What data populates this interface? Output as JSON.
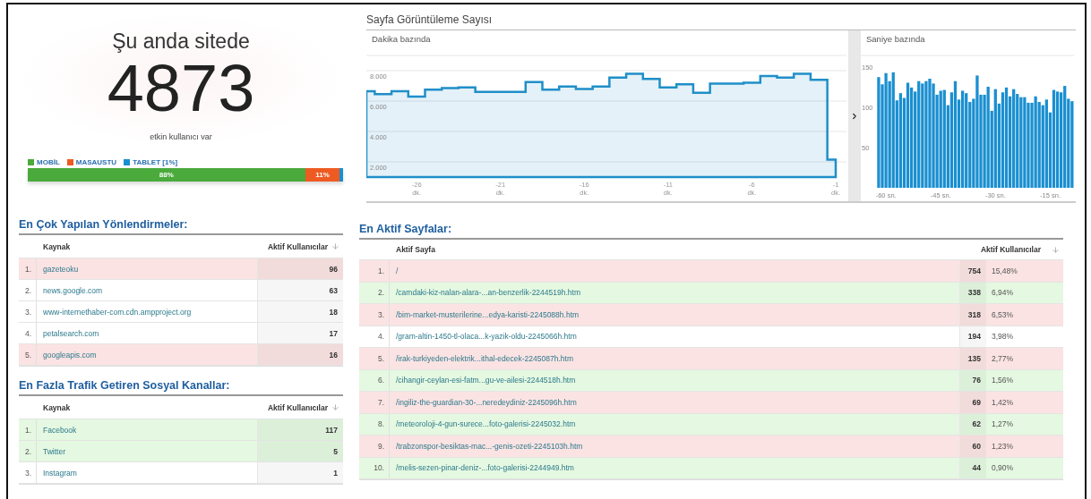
{
  "summary": {
    "title": "Şu anda sitede",
    "count": "4873",
    "caption": "etkin kullanıcı var"
  },
  "devices": [
    {
      "label": "MOBİL",
      "color": "#4aaa3c",
      "level": 0.88,
      "reading": "88%"
    },
    {
      "label": "MASAUSTU",
      "color": "#ee5b22",
      "level": 0.11,
      "reading": "11%"
    },
    {
      "label": "TABLET [1%]",
      "color": "#1a8fd0",
      "level": 0.01
    }
  ],
  "referrals": {
    "title": "En Çok Yapılan Yönlendirmeler:",
    "columns": [
      "Kaynak",
      "Aktif Kullanıcılar"
    ],
    "rows": [
      {
        "rank": "1.",
        "source": "gazeteoku",
        "users": "96",
        "color": "#fbe3e3"
      },
      {
        "rank": "2.",
        "source": "news.google.com",
        "users": "63",
        "color": "#ffffff"
      },
      {
        "rank": "3.",
        "source": "www-internethaber-com.cdn.ampproject.org",
        "users": "18",
        "color": "#ffffff"
      },
      {
        "rank": "4.",
        "source": "petalsearch.com",
        "users": "17",
        "color": "#ffffff"
      },
      {
        "rank": "5.",
        "source": "googleapis.com",
        "users": "16",
        "color": "#fbe3e3"
      }
    ]
  },
  "social": {
    "title": "En Fazla Trafik Getiren Sosyal Kanallar:",
    "columns": [
      "Kaynak",
      "Aktif Kullanıcılar"
    ],
    "rows": [
      {
        "rank": "1.",
        "source": "Facebook",
        "users": "117",
        "color": "#e5f8e1"
      },
      {
        "rank": "2.",
        "source": "Twitter",
        "users": "5",
        "color": "#e5f8e1"
      },
      {
        "rank": "3.",
        "source": "Instagram",
        "users": "1",
        "color": "#ffffff"
      }
    ]
  },
  "pageviews": {
    "title": "Sayfa Görüntüleme Sayısı",
    "minute": {
      "label": "Dakika bazında",
      "chart_data": {
        "type": "area",
        "x": [
          -29,
          -28,
          -27,
          -26,
          -25,
          -24,
          -23,
          -22,
          -21,
          -20,
          -19,
          -18,
          -17,
          -16,
          -15,
          -14,
          -13,
          -12,
          -11,
          -10,
          -9,
          -8,
          -7,
          -6,
          -5,
          -4,
          -3,
          -2,
          -1
        ],
        "xlim": [
          -29,
          -1
        ],
        "grid": true,
        "series": [
          {
            "color": "#1f8fc8",
            "values": [
              6650,
              6450,
              6650,
              6300,
              6750,
              6850,
              6900,
              6600,
              6600,
              6600,
              7250,
              6750,
              6950,
              6800,
              6950,
              7550,
              7800,
              7450,
              6900,
              7100,
              6550,
              7150,
              7150,
              7200,
              7650,
              7550,
              7800,
              7400,
              2150
            ]
          }
        ],
        "ylim": [
          1000,
          9000
        ],
        "yticks": [
          {
            "value": 2000,
            "label": "2.000"
          },
          {
            "value": 4000,
            "label": "4.000"
          },
          {
            "value": 6000,
            "label": "6.000"
          },
          {
            "value": 8000,
            "label": "8.000"
          }
        ],
        "xticks": [
          {
            "value": -26,
            "label": "-26 dk."
          },
          {
            "value": -21,
            "label": "-21 dk."
          },
          {
            "value": -16,
            "label": "-16 dk."
          },
          {
            "value": -11,
            "label": "-11 dk."
          },
          {
            "value": -6,
            "label": "-6 dk."
          },
          {
            "value": -1,
            "label": "-1 dk."
          }
        ]
      }
    },
    "second": {
      "label": "Saniye bazında",
      "chart_data": {
        "type": "bar",
        "x": [
          -62,
          -61,
          -60,
          -59,
          -58,
          -57,
          -56,
          -55,
          -54,
          -53,
          -52,
          -51,
          -50,
          -49,
          -48,
          -47,
          -46,
          -45,
          -44,
          -43,
          -42,
          -41,
          -40,
          -39,
          -38,
          -37,
          -36,
          -35,
          -34,
          -33,
          -32,
          -31,
          -30,
          -29,
          -28,
          -27,
          -26,
          -25,
          -24,
          -23,
          -22,
          -21,
          -20,
          -19,
          -18,
          -17,
          -16,
          -15,
          -14,
          -13,
          -12,
          -11,
          -10,
          -9
        ],
        "xlim": [
          -62.5,
          -8.5
        ],
        "grid": true,
        "series": [
          {
            "color": "#1a8fd0",
            "values": [
              138,
              129,
              143,
              133,
              144,
              109,
              118,
              112,
              131,
              125,
              120,
              133,
              130,
              133,
              136,
              130,
              116,
              121,
              122,
              103,
              119,
              133,
              110,
              121,
              118,
              107,
              111,
              140,
              116,
              116,
              126,
              96,
              123,
              105,
              119,
              125,
              114,
              123,
              117,
              113,
              113,
              106,
              106,
              114,
              107,
              103,
              110,
              94,
              122,
              120,
              119,
              127,
              111,
              108
            ]
          }
        ],
        "ylim": [
          0,
          165
        ],
        "yticks": [
          {
            "value": 50,
            "label": "50"
          },
          {
            "value": 100,
            "label": "100"
          },
          {
            "value": 150,
            "label": "150"
          }
        ],
        "xticks": [
          {
            "value": -60,
            "label": "-60 sn."
          },
          {
            "value": -45,
            "label": "-45 sn."
          },
          {
            "value": -30,
            "label": "-30 sn."
          },
          {
            "value": -15,
            "label": "-15 sn."
          }
        ]
      }
    }
  },
  "pages": {
    "title": "En Aktif Sayfalar:",
    "columns": [
      "Aktif Sayfa",
      "Aktif Kullanıcılar"
    ],
    "rows": [
      {
        "rank": "1.",
        "page": "/",
        "users": "754",
        "share": "15,48%",
        "color": "#fbe3e3"
      },
      {
        "rank": "2.",
        "page": "/camdaki-kiz-nalan-alara-...an-benzerlik-2244519h.htm",
        "users": "338",
        "share": "6,94%",
        "color": "#e5f8e1"
      },
      {
        "rank": "3.",
        "page": "/bim-market-musterilerine...edya-karisti-2245088h.htm",
        "users": "318",
        "share": "6,53%",
        "color": "#fbe3e3"
      },
      {
        "rank": "4.",
        "page": "/gram-altin-1450-tl-olaca...k-yazik-oldu-2245066h.htm",
        "users": "194",
        "share": "3,98%",
        "color": "#ffffff"
      },
      {
        "rank": "5.",
        "page": "/irak-turkiyeden-elektrik...ithal-edecek-2245087h.htm",
        "users": "135",
        "share": "2,77%",
        "color": "#fbe3e3"
      },
      {
        "rank": "6.",
        "page": "/cihangir-ceylan-esi-fatm...gu-ve-ailesi-2244518h.htm",
        "users": "76",
        "share": "1,56%",
        "color": "#e5f8e1"
      },
      {
        "rank": "7.",
        "page": "/ingiliz-the-guardian-30-...neredeydiniz-2245096h.htm",
        "users": "69",
        "share": "1,42%",
        "color": "#fbe3e3"
      },
      {
        "rank": "8.",
        "page": "/meteoroloji-4-gun-surece...foto-galerisi-2245032.htm",
        "users": "62",
        "share": "1,27%",
        "color": "#e5f8e1"
      },
      {
        "rank": "9.",
        "page": "/trabzonspor-besiktas-mac...-genis-ozeti-2245103h.htm",
        "users": "60",
        "share": "1,23%",
        "color": "#fbe3e3"
      },
      {
        "rank": "10.",
        "page": "/melis-sezen-pinar-deniz-...foto-galerisi-2244949.htm",
        "users": "44",
        "share": "0,90%",
        "color": "#e5f8e1"
      }
    ]
  }
}
